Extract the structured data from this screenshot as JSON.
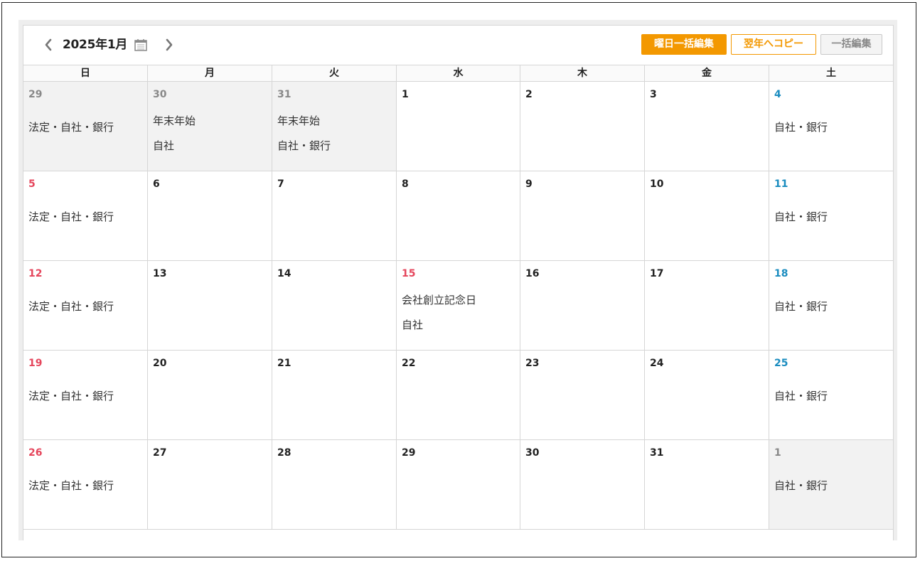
{
  "toolbar": {
    "month_title": "2025年1月",
    "weekday_bulk_edit_label": "曜日一括編集",
    "copy_next_year_label": "翌年へコピー",
    "bulk_edit_label": "一括編集"
  },
  "colors": {
    "accent": "#f39800",
    "sunday": "#e5465c",
    "saturday": "#1a8cbf",
    "other_month_bg": "#f2f2f2"
  },
  "weekdays": [
    "日",
    "月",
    "火",
    "水",
    "木",
    "金",
    "土"
  ],
  "weeks": [
    [
      {
        "day": "29",
        "other": true,
        "labels": [
          "法定・自社・銀行"
        ]
      },
      {
        "day": "30",
        "other": true,
        "labels": [
          "年末年始",
          "自社"
        ]
      },
      {
        "day": "31",
        "other": true,
        "labels": [
          "年末年始",
          "自社・銀行"
        ]
      },
      {
        "day": "1",
        "labels": []
      },
      {
        "day": "2",
        "labels": []
      },
      {
        "day": "3",
        "labels": []
      },
      {
        "day": "4",
        "labels": [
          "自社・銀行"
        ]
      }
    ],
    [
      {
        "day": "5",
        "labels": [
          "法定・自社・銀行"
        ]
      },
      {
        "day": "6",
        "labels": []
      },
      {
        "day": "7",
        "labels": []
      },
      {
        "day": "8",
        "labels": []
      },
      {
        "day": "9",
        "labels": []
      },
      {
        "day": "10",
        "labels": []
      },
      {
        "day": "11",
        "labels": [
          "自社・銀行"
        ]
      }
    ],
    [
      {
        "day": "12",
        "labels": [
          "法定・自社・銀行"
        ]
      },
      {
        "day": "13",
        "labels": []
      },
      {
        "day": "14",
        "labels": []
      },
      {
        "day": "15",
        "holiday": true,
        "labels": [
          "会社創立記念日",
          "自社"
        ]
      },
      {
        "day": "16",
        "labels": []
      },
      {
        "day": "17",
        "labels": []
      },
      {
        "day": "18",
        "labels": [
          "自社・銀行"
        ]
      }
    ],
    [
      {
        "day": "19",
        "labels": [
          "法定・自社・銀行"
        ]
      },
      {
        "day": "20",
        "labels": []
      },
      {
        "day": "21",
        "labels": []
      },
      {
        "day": "22",
        "labels": []
      },
      {
        "day": "23",
        "labels": []
      },
      {
        "day": "24",
        "labels": []
      },
      {
        "day": "25",
        "labels": [
          "自社・銀行"
        ]
      }
    ],
    [
      {
        "day": "26",
        "labels": [
          "法定・自社・銀行"
        ]
      },
      {
        "day": "27",
        "labels": []
      },
      {
        "day": "28",
        "labels": []
      },
      {
        "day": "29",
        "labels": []
      },
      {
        "day": "30",
        "labels": []
      },
      {
        "day": "31",
        "labels": []
      },
      {
        "day": "1",
        "other": true,
        "labels": [
          "自社・銀行"
        ]
      }
    ]
  ]
}
